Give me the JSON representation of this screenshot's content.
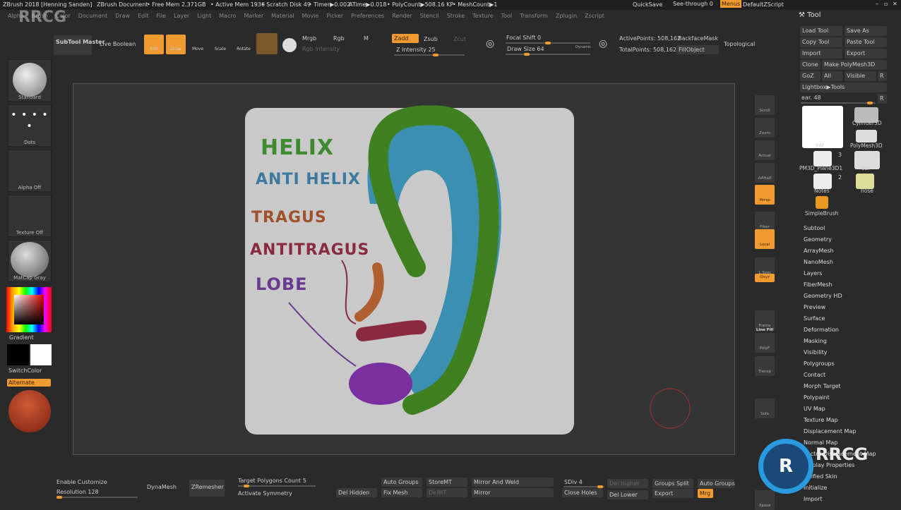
{
  "titlebar": {
    "app": "ZBrush 2018 [Henning Sanden]",
    "document": "ZBrush Document",
    "free_mem": "• Free Mem 2.371GB",
    "active_mem": "• Active Mem 1936",
    "scratch": "• Scratch Disk 49",
    "timer": "• Timer▶0.002",
    "atime": "ATime▶0.018",
    "polycount": "• PolyCount▶508.16 KP",
    "meshcount": "• MeshCount▶1",
    "quicksave": "QuickSave",
    "see_through": "See-through 0",
    "see_through_value": 0,
    "menus": "Menus",
    "script": "DefaultZScript"
  },
  "menu": [
    "Alpha",
    "Brush",
    "Color",
    "Document",
    "Draw",
    "Edit",
    "File",
    "Layer",
    "Light",
    "Macro",
    "Marker",
    "Material",
    "Movie",
    "Picker",
    "Preferences",
    "Render",
    "Stencil",
    "Stroke",
    "Texture",
    "Tool",
    "Transform",
    "Zplugin",
    "Zscript"
  ],
  "toolbar": {
    "subtool_master": "SubTool Master",
    "live_boolean": "Live Boolean",
    "edit": "Edit",
    "draw": "Draw",
    "move": "Move",
    "scale": "Scale",
    "rotate": "Rotate",
    "mrgb": "Mrgb",
    "rgb": "Rgb",
    "m": "M",
    "rgb_intensity": "Rgb Intensity",
    "zadd": "Zadd",
    "zsub": "Zsub",
    "zcut": "Zcut",
    "z_intensity": "Z Intensity 25",
    "z_intensity_value": 25,
    "focal_shift": "Focal Shift 0",
    "focal_shift_value": 0,
    "draw_size": "Draw Size 64",
    "draw_size_value": 64,
    "dynamic": "Dynamic",
    "active_points": "ActivePoints: 508,162",
    "total_points": "TotalPoints: 508,162",
    "backface_mask": "BackfaceMask",
    "fill_object": "FillObject",
    "topological": "Topological"
  },
  "left_panel": {
    "brush": "Standard",
    "stroke": "Dots",
    "alpha": "Alpha Off",
    "texture": "Texture Off",
    "material": "MatCap Gray",
    "gradient": "Gradient",
    "switch_color": "SwitchColor",
    "alternate": "Alternate",
    "colors": {
      "main": "#000000",
      "secondary": "#ffffff",
      "accent": "#f09a30"
    }
  },
  "canvas": {
    "annotations": [
      "HELIX",
      "ANTI HELIX",
      "TRAGUS",
      "ANTITRAGUS",
      "LOBE"
    ]
  },
  "shelf": [
    "Scroll",
    "Zoom",
    "Actual",
    "AAHalf",
    "Persp",
    "Floor",
    "Local",
    "L.Sym",
    "Qxyz",
    "Frame",
    "PolyF",
    "Line Fill",
    "Transp",
    "Dynamic",
    "Solo",
    "Xpose"
  ],
  "tool_panel": {
    "title": "Tool",
    "load_tool": "Load Tool",
    "save_as": "Save As",
    "copy_tool": "Copy Tool",
    "paste_tool": "Paste Tool",
    "import": "Import",
    "export": "Export",
    "clone": "Clone",
    "make_polymesh": "Make PolyMesh3D",
    "goz": "GoZ",
    "all": "All",
    "visible": "Visible",
    "r": "R",
    "lightbox": "Lightbox▶Tools",
    "ear_slider": "ear. 48",
    "ear_value": 48,
    "tools": [
      {
        "name": "ear"
      },
      {
        "name": "Cylinder3D"
      },
      {
        "name": "PolyMesh3D"
      },
      {
        "name": "PM3D_Plane3D1",
        "count": "3"
      },
      {
        "name": "ear"
      },
      {
        "name": "Notes",
        "count": "2"
      },
      {
        "name": "nose"
      },
      {
        "name": "SimpleBrush"
      }
    ],
    "sections": [
      "Subtool",
      "Geometry",
      "ArrayMesh",
      "NanoMesh",
      "Layers",
      "FiberMesh",
      "Geometry HD",
      "Preview",
      "Surface",
      "Deformation",
      "Masking",
      "Visibility",
      "Polygroups",
      "Contact",
      "Morph Target",
      "Polypaint",
      "UV Map",
      "Texture Map",
      "Displacement Map",
      "Normal Map",
      "Vector Displacement Map",
      "Display Properties",
      "Unified Skin",
      "Initialize",
      "Import"
    ]
  },
  "bottom": {
    "enable_customize": "Enable Customize",
    "resolution": "Resolution 128",
    "resolution_value": 128,
    "dynamesh": "DynaMesh",
    "zremesher": "ZRemesher",
    "target_polygons": "Target Polygons Count 5",
    "activate_symmetry": "Activate Symmetry",
    "del_hidden": "Del Hidden",
    "auto_groups": "Auto Groups",
    "fix_mesh": "Fix Mesh",
    "storemt": "StoreMT",
    "delmt": "DelMT",
    "mirror_weld": "Mirror And Weld",
    "mirror": "Mirror",
    "sdiv": "SDiv 4",
    "sdiv_value": 4,
    "close_holes": "Close Holes",
    "del_higher": "Del Higher",
    "del_lower": "Del Lower",
    "groups_split": "Groups Split",
    "export": "Export",
    "auto_groups2": "Auto Groups",
    "mrg": "Mrg"
  },
  "watermark": "RRCG"
}
